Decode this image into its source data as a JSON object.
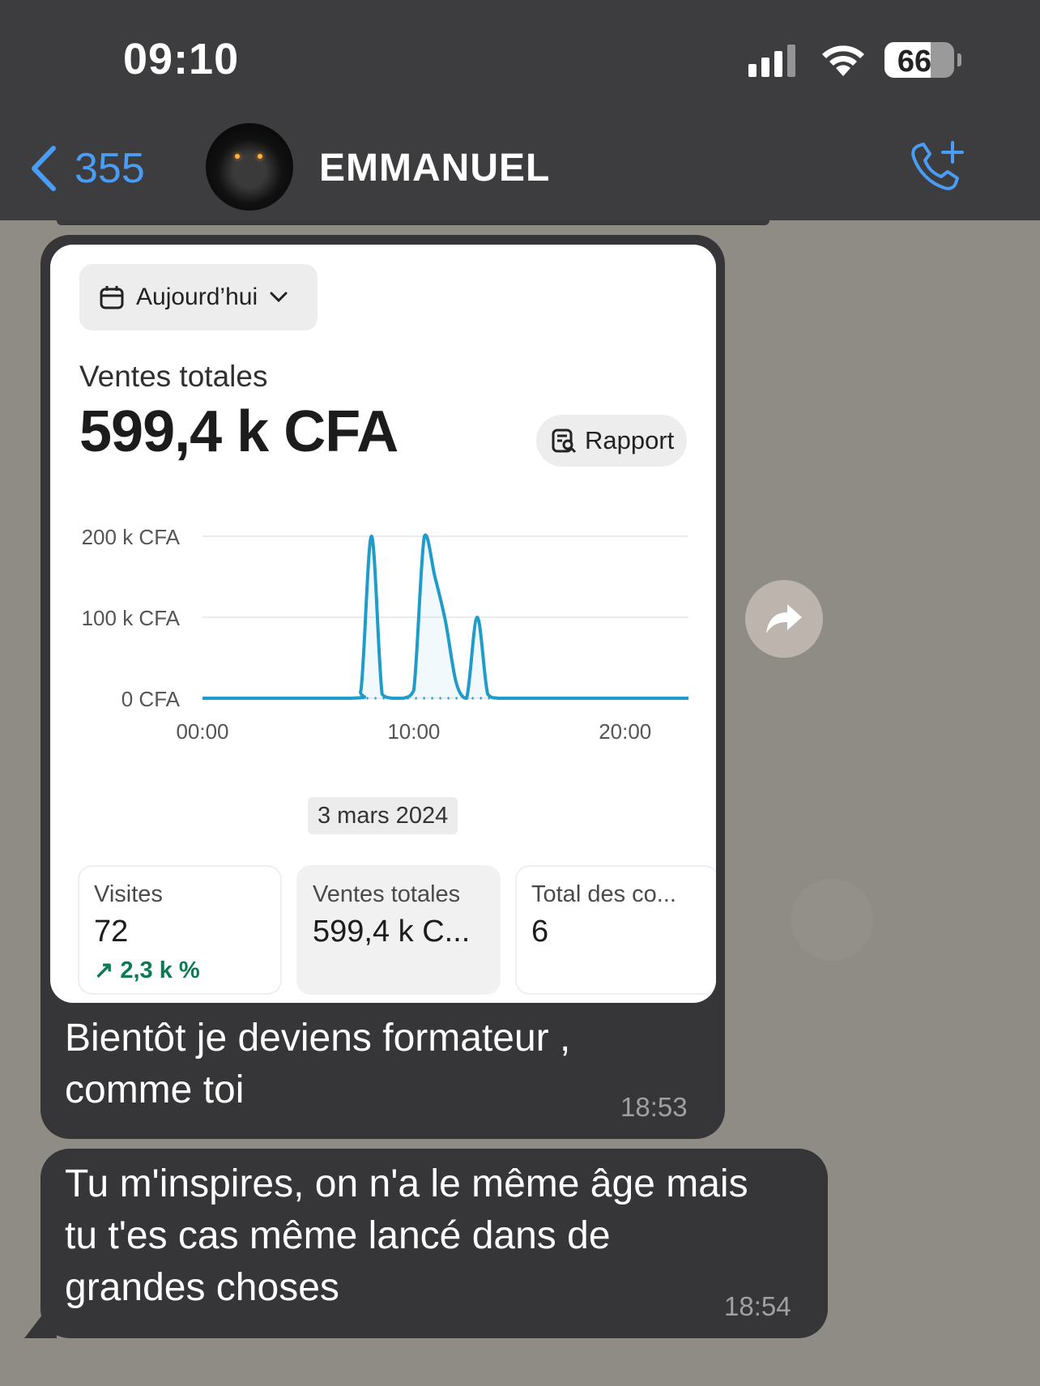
{
  "status_bar": {
    "time": "09:10",
    "battery": "66",
    "battery_level": 0.66
  },
  "header": {
    "back_count": "355",
    "contact_name": "EMMANUEL",
    "icons": {
      "back": "chevron-left-icon",
      "call": "add-call-icon"
    }
  },
  "messages": [
    {
      "card": {
        "date_filter": "Aujourd’hui",
        "sales_label": "Ventes totales",
        "sales_value": "599,4 k CFA",
        "report_label": "Rapport",
        "chart_date": "3 mars 2024",
        "metrics": [
          {
            "label": "Visites",
            "value": "72",
            "delta": "2,3 k %"
          },
          {
            "label": "Ventes totales",
            "value": "599,4 k C..."
          },
          {
            "label": "Total des co...",
            "value": "6"
          }
        ]
      },
      "text_line1": "Bientôt je deviens formateur ,",
      "text_line2": "comme toi",
      "time": "18:53"
    },
    {
      "text_line1": "Tu m'inspires, on n'a le même âge mais",
      "text_line2": "tu t'es cas même lancé dans de",
      "text_line3": "grandes choses",
      "time": "18:54"
    }
  ],
  "chart_data": {
    "type": "line",
    "x_ticks": [
      "00:00",
      "10:00",
      "20:00"
    ],
    "y_ticks": [
      "0 CFA",
      "100 k CFA",
      "200 k CFA"
    ],
    "ylim": [
      0,
      200000
    ],
    "xlim": [
      0,
      23
    ],
    "series": [
      {
        "color": "#1f9cc9",
        "x": [
          0,
          7,
          7.5,
          8,
          8.5,
          9,
          9.5,
          10,
          10.5,
          11,
          11.5,
          12,
          12.5,
          13,
          13.5,
          14,
          15,
          23
        ],
        "y": [
          0,
          0,
          10000,
          200000,
          5000,
          0,
          0,
          10000,
          200000,
          150000,
          95000,
          20000,
          0,
          100000,
          5000,
          0,
          0,
          0
        ]
      }
    ],
    "grid": true
  },
  "colors": {
    "accent": "#4a9df5",
    "bubble": "#363638",
    "line": "#1f9cc9",
    "delta_up": "#0a7a50"
  }
}
